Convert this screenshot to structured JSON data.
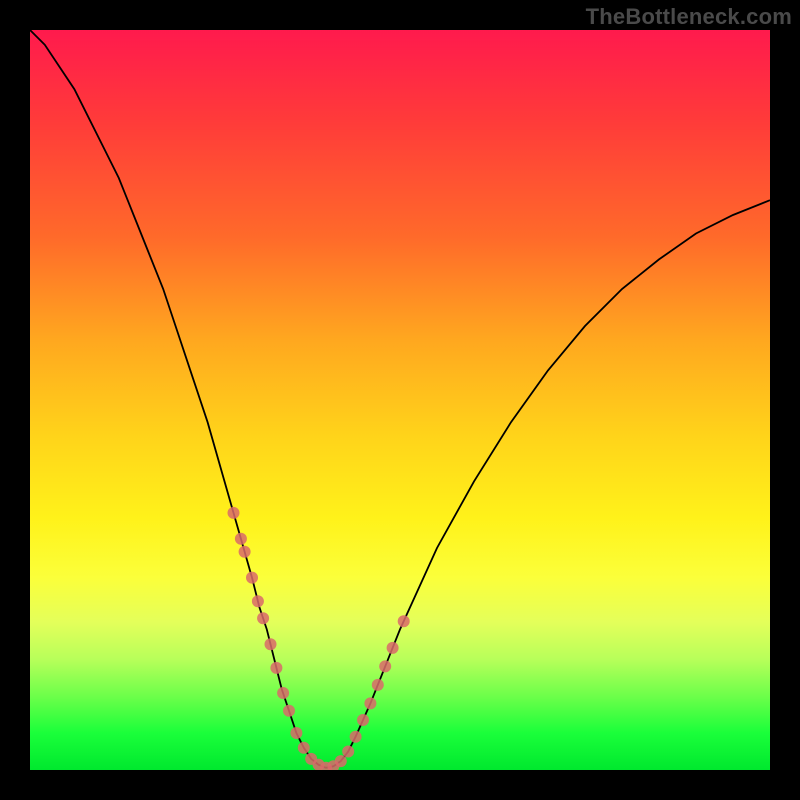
{
  "watermark": "TheBottleneck.com",
  "colors": {
    "frame": "#000000",
    "curve": "#000000",
    "tick_marker": "#d96a6a",
    "gradient_top": "#ff1a4d",
    "gradient_bottom": "#00e82e"
  },
  "chart_data": {
    "type": "line",
    "title": "",
    "xlabel": "",
    "ylabel": "",
    "xlim": [
      0,
      100
    ],
    "ylim": [
      0,
      100
    ],
    "x": [
      0,
      2,
      4,
      6,
      8,
      10,
      12,
      14,
      16,
      18,
      20,
      22,
      24,
      26,
      28,
      30,
      31,
      32,
      33,
      34,
      35,
      36,
      37,
      38,
      39,
      40,
      41,
      42,
      43,
      44,
      46,
      48,
      50,
      55,
      60,
      65,
      70,
      75,
      80,
      85,
      90,
      95,
      100
    ],
    "values": [
      100,
      98,
      95,
      92,
      88,
      84,
      80,
      75,
      70,
      65,
      59,
      53,
      47,
      40,
      33,
      26,
      22,
      19,
      15,
      11,
      8,
      5,
      3,
      1.5,
      0.7,
      0.3,
      0.5,
      1.2,
      2.5,
      4.5,
      9,
      14,
      19,
      30,
      39,
      47,
      54,
      60,
      65,
      69,
      72.5,
      75,
      77
    ],
    "tick_markers_x": [
      27.5,
      28.5,
      29,
      30,
      30.8,
      31.5,
      32.5,
      33.3,
      34.2,
      35,
      36,
      37,
      38,
      39,
      40,
      41,
      42,
      43,
      44,
      45,
      46,
      47,
      48,
      49,
      50.5
    ]
  }
}
